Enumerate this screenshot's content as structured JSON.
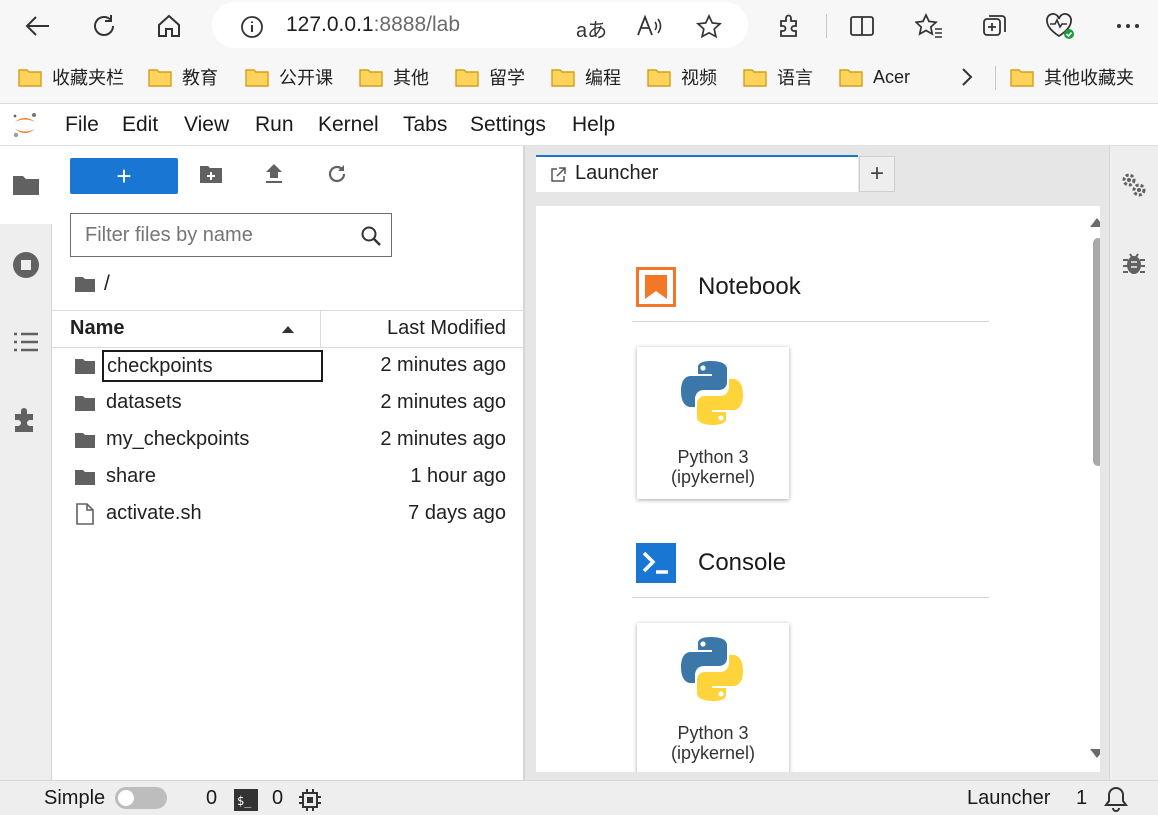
{
  "browser": {
    "url_host": "127.0.0.1",
    "url_rest": ":8888/lab",
    "bookmarks": [
      "收藏夹栏",
      "教育",
      "公开课",
      "其他",
      "留学",
      "编程",
      "视频",
      "语言",
      "Acer"
    ],
    "other_bookmarks": "其他收藏夹"
  },
  "menubar": {
    "items": [
      "File",
      "Edit",
      "View",
      "Run",
      "Kernel",
      "Tabs",
      "Settings",
      "Help"
    ]
  },
  "file_browser": {
    "new_label": "+",
    "filter_placeholder": "Filter files by name",
    "breadcrumb": "/",
    "header_name": "Name",
    "header_modified": "Last Modified",
    "files": [
      {
        "name": "checkpoints",
        "modified": "2 minutes ago",
        "type": "folder"
      },
      {
        "name": "datasets",
        "modified": "2 minutes ago",
        "type": "folder"
      },
      {
        "name": "my_checkpoints",
        "modified": "2 minutes ago",
        "type": "folder"
      },
      {
        "name": "share",
        "modified": "1 hour ago",
        "type": "folder"
      },
      {
        "name": "activate.sh",
        "modified": "7 days ago",
        "type": "file"
      }
    ]
  },
  "tabs": {
    "launcher": "Launcher",
    "new_tab": "+"
  },
  "launcher": {
    "notebook_title": "Notebook",
    "notebook_kernel": [
      "Python 3",
      "(ipykernel)"
    ],
    "console_title": "Console",
    "console_kernel": [
      "Python 3",
      "(ipykernel)"
    ]
  },
  "statusbar": {
    "simple_label": "Simple",
    "simple_enabled": false,
    "terminals_count": "0",
    "kernels_count": "0",
    "active_tab": "Launcher",
    "notifications": "1"
  },
  "colors": {
    "accent": "#1976d2",
    "notebook_orange": "#f37726",
    "python_blue": "#3b77a8",
    "python_yellow": "#ffd43b"
  }
}
